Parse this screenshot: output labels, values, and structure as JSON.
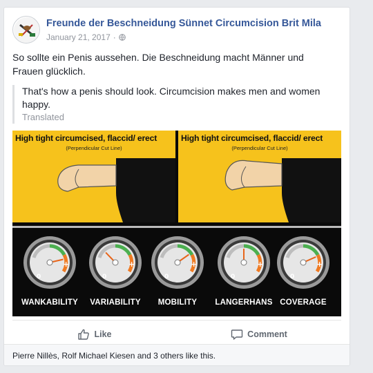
{
  "post": {
    "page_name": "Freunde der Beschneidung Sünnet Circumcision Brit Mila",
    "date": "January 21, 2017",
    "meta_separator": "·",
    "text": "So sollte ein Penis aussehen. Die Beschneidung macht Männer und Frauen glücklich.",
    "translation": "That's how a penis should look. Circumcision makes men and women happy.",
    "translated_label": "Translated"
  },
  "image": {
    "panels": [
      {
        "title": "High tight circumcised, flaccid/ erect",
        "subtitle": "(Perpendicular Cut Line)"
      },
      {
        "title": "High tight circumcised, flaccid/ erect",
        "subtitle": "(Perpendicular Cut Line)"
      }
    ],
    "gauges": [
      {
        "label": "WANKABILITY",
        "level": 0.85
      },
      {
        "label": "VARIABILITY",
        "level": 0.3
      },
      {
        "label": "MOBILITY",
        "level": 0.75
      },
      {
        "label": "LANGERHANS",
        "level": 0.5
      },
      {
        "label": "COVERAGE",
        "level": 0.8
      }
    ]
  },
  "actions": {
    "like_label": "Like",
    "comment_label": "Comment"
  },
  "likes": {
    "text": "Pierre Nillès, Rolf Michael Kiesen and 3 others like this."
  },
  "colors": {
    "link": "#365899",
    "panel_yellow": "#f6c21c"
  }
}
